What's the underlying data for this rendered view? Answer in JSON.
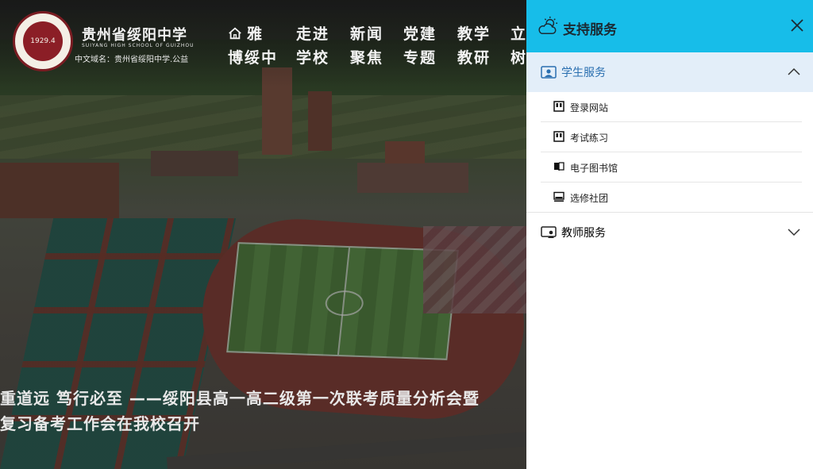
{
  "site": {
    "name_cn": "贵州省绥阳中学",
    "name_en": "SUIYANG HIGH SCHOOL OF GUIZHOU",
    "domain_text": "中文域名：贵州省绥阳中学.公益",
    "logo_year": "1929.4"
  },
  "nav": [
    {
      "top": "雅",
      "bottom": "博绥中",
      "icon": "home-icon"
    },
    {
      "top": "走进",
      "bottom": "学校"
    },
    {
      "top": "新闻",
      "bottom": "聚焦"
    },
    {
      "top": "党建",
      "bottom": "专题"
    },
    {
      "top": "教学",
      "bottom": "教研"
    },
    {
      "top": "立",
      "bottom": "树"
    }
  ],
  "headline": {
    "line1": "重道远 笃行必至 ——绥阳县高一高二级第一次联考质量分析会暨",
    "line2": "复习备考工作会在我校召开"
  },
  "panel": {
    "title": "支持服务",
    "title_icon": "cloud-sun-icon",
    "close_icon": "close-icon",
    "header_color": "#17bde9",
    "groups": [
      {
        "label": "学生服务",
        "icon": "student-icon",
        "expanded": true,
        "items": [
          {
            "label": "登录网站",
            "icon": "portal-icon"
          },
          {
            "label": "考试练习",
            "icon": "exam-icon"
          },
          {
            "label": "电子图书馆",
            "icon": "book-icon"
          },
          {
            "label": "选修社团",
            "icon": "monitor-icon"
          }
        ]
      },
      {
        "label": "教师服务",
        "icon": "teacher-icon",
        "expanded": false,
        "items": []
      }
    ]
  }
}
